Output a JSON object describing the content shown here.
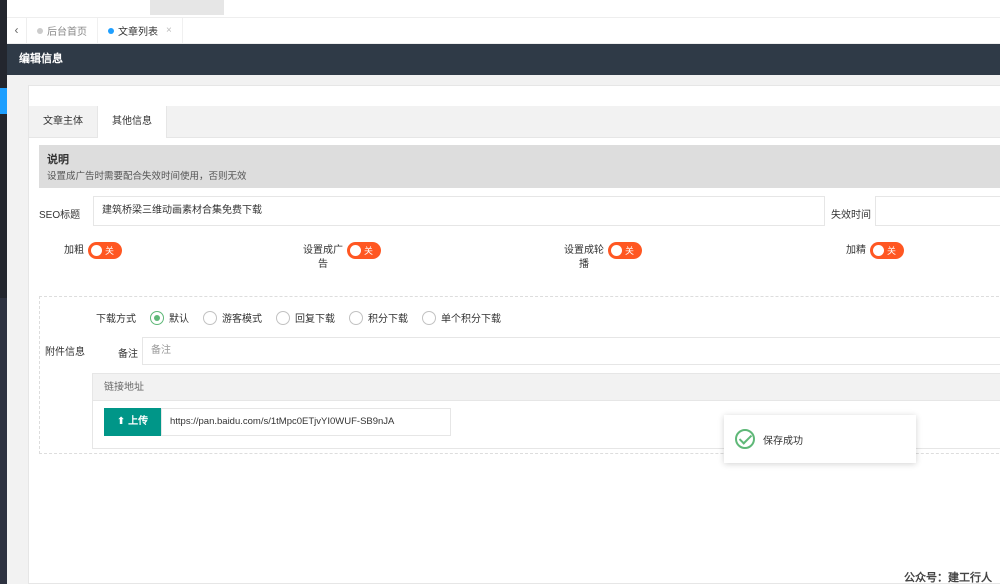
{
  "tabs": {
    "back_icon": "chevron-left-icon",
    "home": "后台首页",
    "article_list": "文章列表",
    "close_symbol": "×"
  },
  "header": {
    "title": "编辑信息"
  },
  "form_tabs": [
    "文章主体",
    "其他信息"
  ],
  "note": {
    "title": "说明",
    "desc": "设置成广告时需要配合失效时间使用，否则无效"
  },
  "seo": {
    "label": "SEO标题",
    "value": "建筑桥梁三维动画素材合集免费下载",
    "expire_label": "失效时间",
    "expire_value": ""
  },
  "switches": [
    {
      "label": "加粗",
      "state": "关"
    },
    {
      "label": "设置成广告",
      "state": "关"
    },
    {
      "label": "设置成轮播",
      "state": "关"
    },
    {
      "label": "加精",
      "state": "关"
    }
  ],
  "attachment": {
    "label": "附件信息",
    "download_label": "下载方式",
    "download_options": [
      "默认",
      "游客模式",
      "回复下载",
      "积分下载",
      "单个积分下载"
    ],
    "selected_option": "默认",
    "remark_label": "备注",
    "remark_placeholder": "备注",
    "link_header": "链接地址",
    "upload_label": "上传",
    "url_value": "https://pan.baidu.com/s/1tMpc0ETjvYI0WUF-SB9nJA"
  },
  "toast": {
    "message": "保存成功"
  },
  "watermark": "公众号：建工行人",
  "colors": {
    "accent": "#1e9fff",
    "switch_off": "#ff5722",
    "upload": "#009688",
    "success": "#5fb878",
    "header_bg": "#2f3a47"
  }
}
